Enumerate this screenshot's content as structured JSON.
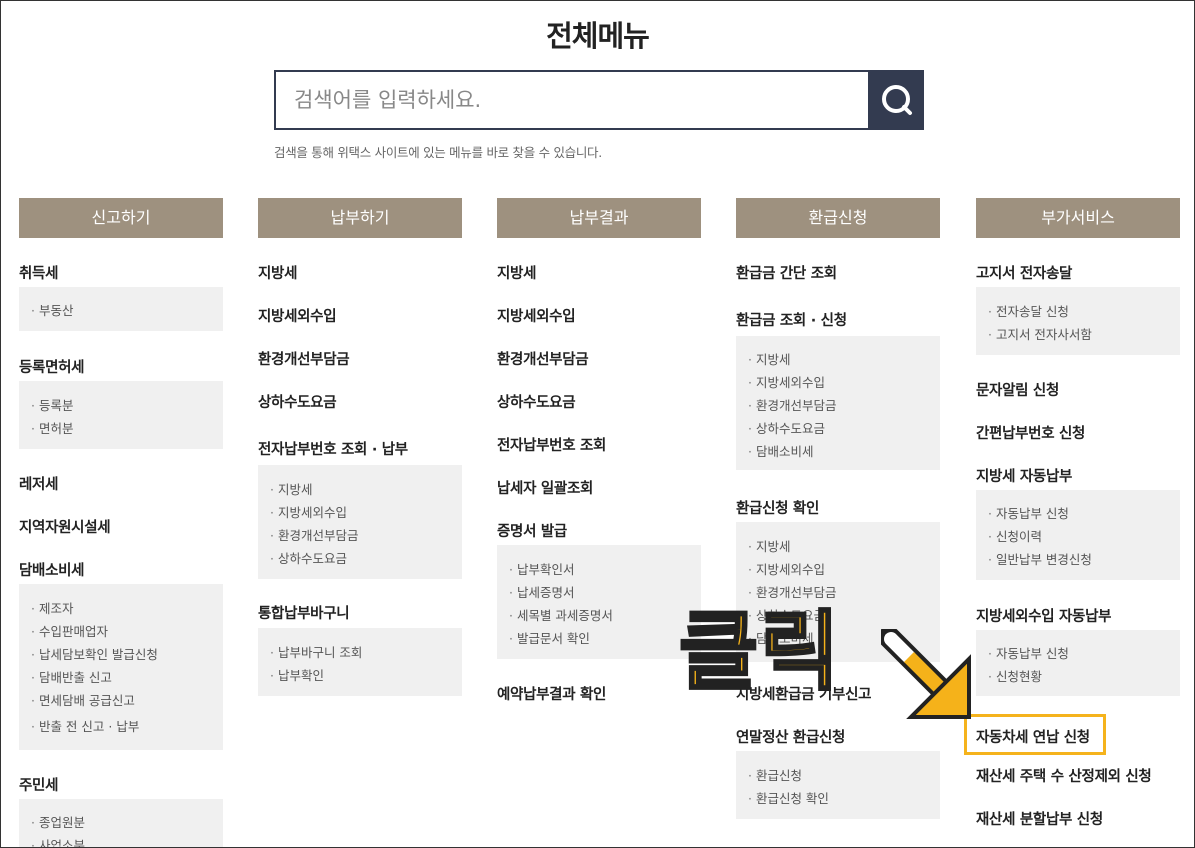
{
  "title": "전체메뉴",
  "search": {
    "placeholder": "검색어를 입력하세요.",
    "hint": "검색을 통해 위택스 사이트에 있는 메뉴를 바로 찾을 수 있습니다."
  },
  "icons": {
    "search": "search-icon",
    "arrow": "arrow-icon"
  },
  "colors": {
    "header_bg": "#9e917f",
    "search_btn": "#333b50",
    "highlight": "#f5b31c",
    "sub_bg": "#f0f0f0"
  },
  "col1": {
    "header": "신고하기",
    "acq": "취득세",
    "acq_subs": [
      "부동산"
    ],
    "reg": "등록면허세",
    "reg_subs": [
      "등록분",
      "면허분"
    ],
    "leisure": "레저세",
    "regional": "지역자원시설세",
    "tobacco": "담배소비세",
    "tobacco_subs": [
      "제조자",
      "수입판매업자",
      "납세담보확인 발급신청",
      "담배반출 신고",
      "면세담배 공급신고",
      "반출 전 신고 · 납부"
    ],
    "resident": "주민세",
    "resident_subs": [
      "종업원분",
      "사업소분"
    ]
  },
  "col2": {
    "header": "납부하기",
    "local": "지방세",
    "nontax": "지방세외수입",
    "env": "환경개선부담금",
    "water": "상하수도요금",
    "enum": "전자납부번호 조회 · 납부",
    "enum_subs": [
      "지방세",
      "지방세외수입",
      "환경개선부담금",
      "상하수도요금"
    ],
    "cart": "통합납부바구니",
    "cart_subs": [
      "납부바구니 조회",
      "납부확인"
    ]
  },
  "col3": {
    "header": "납부결과",
    "local": "지방세",
    "nontax": "지방세외수입",
    "env": "환경개선부담금",
    "water": "상하수도요금",
    "enum": "전자납부번호 조회",
    "taxpayer": "납세자 일괄조회",
    "cert": "증명서 발급",
    "cert_subs": [
      "납부확인서",
      "납세증명서",
      "세목별 과세증명서",
      "발급문서 확인"
    ],
    "reserve": "예약납부결과 확인"
  },
  "col4": {
    "header": "환급신청",
    "simple": "환급금 간단 조회",
    "inquiry": "환급금 조회 · 신청",
    "inquiry_subs": [
      "지방세",
      "지방세외수입",
      "환경개선부담금",
      "상하수도요금",
      "담배소비세"
    ],
    "check": "환급신청 확인",
    "check_subs": [
      "지방세",
      "지방세외수입",
      "환경개선부담금",
      "상하수도요금",
      "담배소비세"
    ],
    "partial": "지방세환급금 기부신고",
    "yearend": "연말정산 환급신청",
    "yearend_subs": [
      "환급신청",
      "환급신청 확인"
    ]
  },
  "col5": {
    "header": "부가서비스",
    "bill": "고지서 전자송달",
    "bill_subs": [
      "전자송달 신청",
      "고지서 전자사서함"
    ],
    "sms": "문자알림 신청",
    "easy": "간편납부번호 신청",
    "auto": "지방세 자동납부",
    "auto_subs": [
      "자동납부 신청",
      "신청이력",
      "일반납부 변경신청"
    ],
    "auto2": "지방세외수입 자동납부",
    "auto2_subs": [
      "자동납부 신청",
      "신청현황"
    ],
    "car": "자동차세 연납 신청",
    "house": "재산세 주택 수 산정제외 신청",
    "split": "재산세 분할납부 신청"
  },
  "annotation": {
    "click": "클릭"
  }
}
